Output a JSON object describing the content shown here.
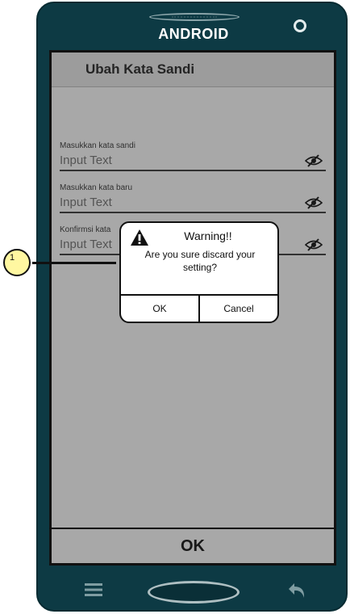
{
  "device": {
    "brand": "ANDROID",
    "speaker_icon": "speaker-grill-icon",
    "camera_icon": "front-camera-icon"
  },
  "screen": {
    "title": "Ubah Kata Sandi",
    "fields": [
      {
        "label": "Masukkan kata sandi",
        "placeholder": "Input Text",
        "icon": "eye-off-icon"
      },
      {
        "label": "Masukkan kata  baru",
        "placeholder": "Input Text",
        "icon": "eye-off-icon"
      },
      {
        "label": "Konfirmsi kata",
        "placeholder": "Input Text",
        "icon": "eye-off-icon"
      }
    ],
    "ok_label": "OK"
  },
  "dialog": {
    "icon": "warning-icon",
    "title": "Warning!!",
    "message": "Are you sure discard your setting?",
    "ok_label": "OK",
    "cancel_label": "Cancel"
  },
  "annotation": {
    "number": "1"
  },
  "nav": {
    "menu_icon": "menu-icon",
    "home_icon": "home-button",
    "back_icon": "back-icon"
  },
  "colors": {
    "phone_body": "#0d3a44",
    "screen_bg": "#e9e9e9",
    "overlay": "#8f8f8f",
    "callout_fill": "#fff7a1"
  }
}
